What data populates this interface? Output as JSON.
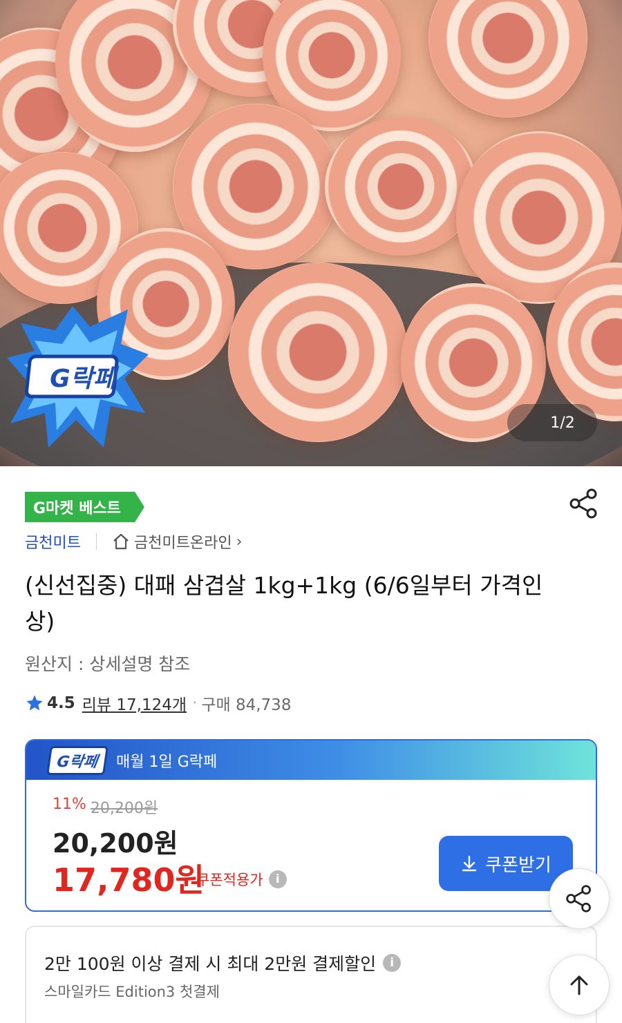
{
  "hero": {
    "image_counter": "1/2",
    "badge_logo_text": "G락페"
  },
  "product": {
    "best_tag": "G마켓 베스트",
    "seller_name": "금천미트",
    "store_link": "금천미트온라인",
    "store_chevron": "›",
    "title": "(신선집중) 대패 삼겹살 1kg+1kg (6/6일부터 가격인상)",
    "origin": "원산지 : 상세설명 참조",
    "rating": "4.5",
    "reviews": "리뷰 17,124개",
    "purchase": "구매 84,738"
  },
  "deal": {
    "logo": "G락페",
    "header_text": "매월 1일 G락페",
    "discount_pct": "11%",
    "original_price": "20,200원",
    "price": "20,200원",
    "coupon_price": "17,780원",
    "coupon_price_label": "쿠폰적용가",
    "coupon_button": "쿠폰받기",
    "colors": {
      "accent": "#2f6fe6",
      "sale": "#e0261e",
      "best_green": "#33b348"
    }
  },
  "promo": {
    "title": "2만 100원 이상 결제 시 최대 2만원 결제할인",
    "subtitle": "스마일카드 Edition3 첫결제"
  },
  "icons": {
    "share": "share-icon",
    "scroll_top": "arrow-up-icon",
    "download": "download-icon",
    "home": "home-icon",
    "star": "star-icon",
    "info": "info-icon"
  }
}
